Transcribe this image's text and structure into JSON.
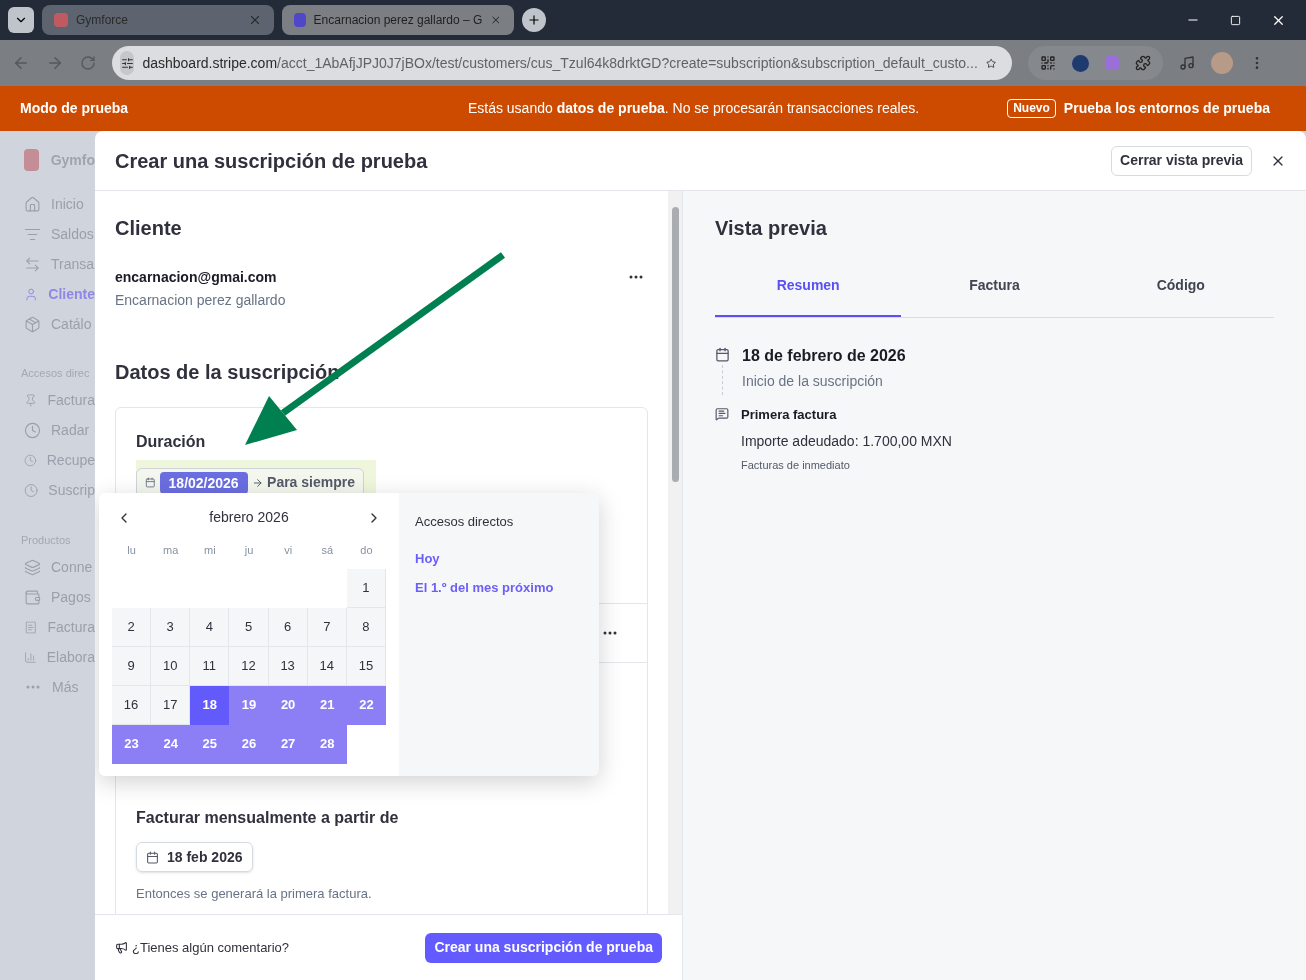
{
  "browser": {
    "tabs": [
      {
        "title": "Gymforce",
        "selected": false
      },
      {
        "title": "Encarnacion perez gallardo – G",
        "selected": true
      }
    ],
    "address": {
      "host": "dashboard.stripe.com",
      "path": "/acct_1AbAfjJPJ0J7jBOx/test/customers/cus_Tzul64k8drktGD?create=subscription&subscription_default_custo..."
    }
  },
  "test_banner": {
    "label": "Modo de prueba",
    "message": "Estás usando **datos de prueba**. No se procesarán transacciones reales.",
    "badge": "Nuevo",
    "link": "Prueba los entornos de prueba"
  },
  "sidebar": {
    "brand": "Gymfo",
    "items": [
      {
        "label": "Inicio",
        "selected": false
      },
      {
        "label": "Saldos",
        "selected": false
      },
      {
        "label": "Transa",
        "selected": false
      },
      {
        "label": "Cliente",
        "selected": true
      },
      {
        "label": "Catálo",
        "selected": false
      }
    ],
    "sections": [
      {
        "title": "Accesos direc",
        "items": [
          {
            "label": "Factura",
            "selected": false
          },
          {
            "label": "Radar",
            "selected": false
          },
          {
            "label": "Recupe",
            "selected": false
          },
          {
            "label": "Suscrip",
            "selected": false
          }
        ]
      },
      {
        "title": "Productos",
        "items": [
          {
            "label": "Conne",
            "selected": false
          },
          {
            "label": "Pagos",
            "selected": false
          },
          {
            "label": "Factura",
            "selected": false
          },
          {
            "label": "Elabora",
            "selected": false
          },
          {
            "label": "Más",
            "selected": false
          }
        ]
      }
    ]
  },
  "modal": {
    "title": "Crear una suscripción de prueba",
    "close_preview_button": "Cerrar vista previa",
    "customer": {
      "heading": "Cliente",
      "email": "encarnacion@gmai.com",
      "name": "Encarnacion perez gallardo"
    },
    "subscription": {
      "heading": "Datos de la suscripción",
      "duration": {
        "label": "Duración",
        "start": "18/02/2026",
        "end": "Para siempre"
      },
      "billing": {
        "label": "Facturar mensualmente a partir de",
        "date": "18 feb 2026",
        "hint": "Entonces se generará la primera factura."
      }
    },
    "date_picker": {
      "month": "febrero 2026",
      "weekdays": [
        "lu",
        "ma",
        "mi",
        "ju",
        "vi",
        "sá",
        "do"
      ],
      "weeks": [
        [
          {
            "kind": "empty"
          },
          {
            "kind": "empty"
          },
          {
            "kind": "empty"
          },
          {
            "kind": "empty"
          },
          {
            "kind": "empty"
          },
          {
            "kind": "empty"
          },
          {
            "kind": "day",
            "day": "1",
            "selected": false,
            "in_range": false
          }
        ],
        [
          {
            "day": "2",
            "selected": false,
            "in_range": false
          },
          {
            "day": "3",
            "selected": false,
            "in_range": false
          },
          {
            "day": "4",
            "selected": false,
            "in_range": false
          },
          {
            "day": "5",
            "selected": false,
            "in_range": false
          },
          {
            "day": "6",
            "selected": false,
            "in_range": false
          },
          {
            "day": "7",
            "selected": false,
            "in_range": false
          },
          {
            "day": "8",
            "selected": false,
            "in_range": false
          }
        ],
        [
          {
            "day": "9",
            "selected": false,
            "in_range": false
          },
          {
            "day": "10",
            "selected": false,
            "in_range": false
          },
          {
            "day": "11",
            "selected": false,
            "in_range": false
          },
          {
            "day": "12",
            "selected": false,
            "in_range": false
          },
          {
            "day": "13",
            "selected": false,
            "in_range": false
          },
          {
            "day": "14",
            "selected": false,
            "in_range": false
          },
          {
            "day": "15",
            "selected": false,
            "in_range": false
          }
        ],
        [
          {
            "day": "16",
            "selected": false,
            "in_range": false
          },
          {
            "day": "17",
            "selected": false,
            "in_range": false
          },
          {
            "day": "18",
            "selected": true,
            "in_range": false
          },
          {
            "day": "19",
            "selected": false,
            "in_range": true
          },
          {
            "day": "20",
            "selected": false,
            "in_range": true
          },
          {
            "day": "21",
            "selected": false,
            "in_range": true
          },
          {
            "day": "22",
            "selected": false,
            "in_range": true
          }
        ],
        [
          {
            "day": "23",
            "selected": false,
            "in_range": true
          },
          {
            "day": "24",
            "selected": false,
            "in_range": true
          },
          {
            "day": "25",
            "selected": false,
            "in_range": true
          },
          {
            "day": "26",
            "selected": false,
            "in_range": true
          },
          {
            "day": "27",
            "selected": false,
            "in_range": true
          },
          {
            "day": "28",
            "selected": false,
            "in_range": true
          },
          {
            "kind": "empty"
          }
        ]
      ],
      "shortcuts_title": "Accesos directos",
      "shortcuts": [
        "Hoy",
        "El 1.º del mes próximo"
      ]
    },
    "feedback": "¿Tienes algún comentario?",
    "submit_button": "Crear una suscripción de prueba",
    "preview": {
      "heading": "Vista previa",
      "tabs": [
        {
          "label": "Resumen",
          "selected": true
        },
        {
          "label": "Factura",
          "selected": false
        },
        {
          "label": "Código",
          "selected": false
        }
      ],
      "timeline": [
        {
          "kind": "date",
          "title": "18 de febrero de 2026",
          "subtitle": "Inicio de la suscripción"
        },
        {
          "kind": "invoice",
          "title": "Primera factura",
          "detail": "Importe adeudado: 1.700,00 MXN",
          "note": "Facturas de inmediato"
        }
      ]
    }
  }
}
